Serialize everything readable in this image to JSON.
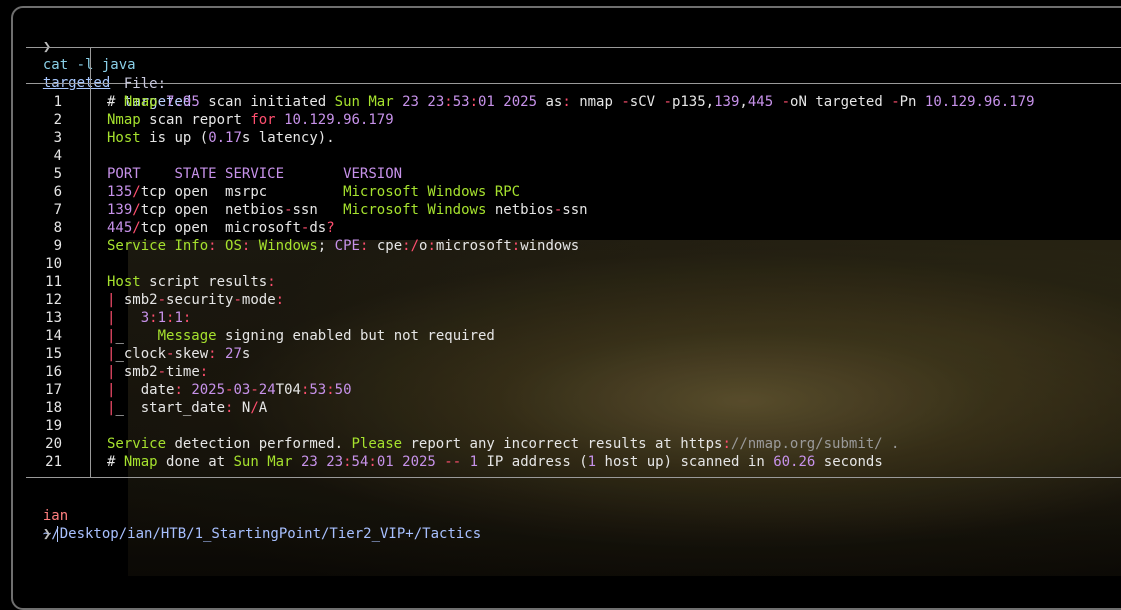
{
  "prompt": {
    "symbol": "❯",
    "command": "cat -l java",
    "argument": "targeted"
  },
  "file_header": {
    "label": "File:",
    "name": "targeted"
  },
  "line_numbers": [
    "1",
    "2",
    "3",
    "4",
    "5",
    "6",
    "7",
    "8",
    "9",
    "10",
    "11",
    "12",
    "13",
    "14",
    "15",
    "16",
    "17",
    "18",
    "19",
    "20",
    "21"
  ],
  "lines": [
    "# Nmap 7.95 scan initiated Sun Mar 23 23:53:01 2025 as: nmap -sCV -p135,139,445 -oN targeted -Pn 10.129.96.179",
    "Nmap scan report for 10.129.96.179",
    "Host is up (0.17s latency).",
    "",
    "PORT    STATE SERVICE       VERSION",
    "135/tcp open  msrpc         Microsoft Windows RPC",
    "139/tcp open  netbios-ssn   Microsoft Windows netbios-ssn",
    "445/tcp open  microsoft-ds?",
    "Service Info: OS: Windows; CPE: cpe:/o:microsoft:windows",
    "",
    "Host script results:",
    "| smb2-security-mode:",
    "|   3:1:1:",
    "|_    Message signing enabled but not required",
    "|_clock-skew: 27s",
    "| smb2-time:",
    "|   date: 2025-03-24T04:53:50",
    "|_  start_date: N/A",
    "",
    "Service detection performed. Please report any incorrect results at https://nmap.org/submit/ .",
    "# Nmap done at Sun Mar 23 23:54:01 2025 -- 1 IP address (1 host up) scanned in 60.26 seconds"
  ],
  "shell": {
    "user": "ian",
    "path": "~/Desktop/ian/HTB/1_StartingPoint/Tier2_VIP+/Tactics",
    "prompt_symbol": "❯"
  }
}
